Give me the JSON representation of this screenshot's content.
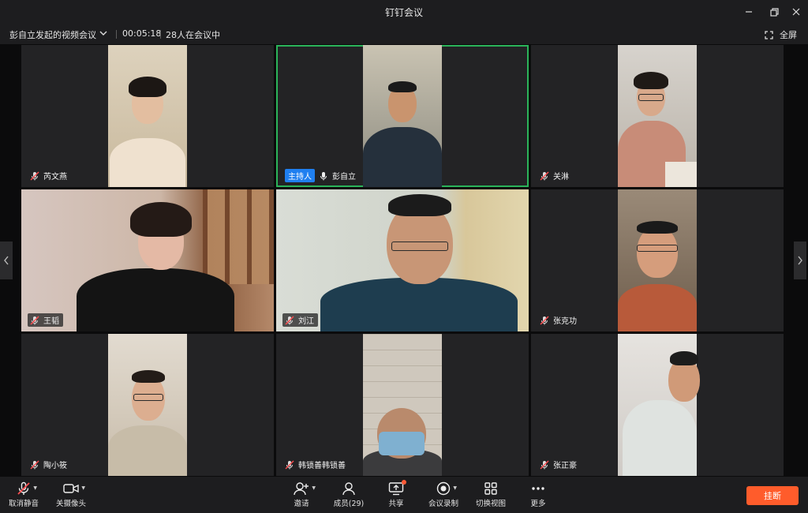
{
  "window": {
    "title": "钉钉会议"
  },
  "info": {
    "meeting_name": "彭自立发起的视频会议",
    "duration": "00:05:18",
    "participant_status": "28人在会议中",
    "fullscreen_label": "全屏"
  },
  "participants": [
    {
      "name": "芮文燕",
      "mic": "muted"
    },
    {
      "name": "彭自立",
      "mic": "on",
      "host_badge": "主持人",
      "active_speaker": true
    },
    {
      "name": "关淋",
      "mic": "muted"
    },
    {
      "name": "王韬",
      "mic": "muted"
    },
    {
      "name": "刘江",
      "mic": "muted"
    },
    {
      "name": "张克功",
      "mic": "muted"
    },
    {
      "name": "陶小筱",
      "mic": "muted"
    },
    {
      "name": "韩锁善韩锁善",
      "mic": "muted"
    },
    {
      "name": "张正豪",
      "mic": "muted"
    }
  ],
  "toolbar": {
    "mute": "取消静音",
    "camera": "关摄像头",
    "invite": "邀请",
    "members": "成员(29)",
    "share": "共享",
    "record": "会议录制",
    "switch_view": "切换视图",
    "more": "更多",
    "hangup": "挂断"
  },
  "icons": [
    "minimize-icon",
    "restore-icon",
    "close-icon",
    "chevron-down-icon",
    "fullscreen-icon",
    "mic-muted-icon",
    "mic-icon",
    "camera-icon",
    "invite-icon",
    "members-icon",
    "share-screen-icon",
    "record-icon",
    "grid-view-icon",
    "more-icon",
    "chevron-left-icon",
    "chevron-right-icon"
  ],
  "colors": {
    "accent": "#1f7ff0",
    "active_border": "#2bb45a",
    "hangup": "#ff5c2b",
    "mute_red": "#ff4d4f"
  }
}
